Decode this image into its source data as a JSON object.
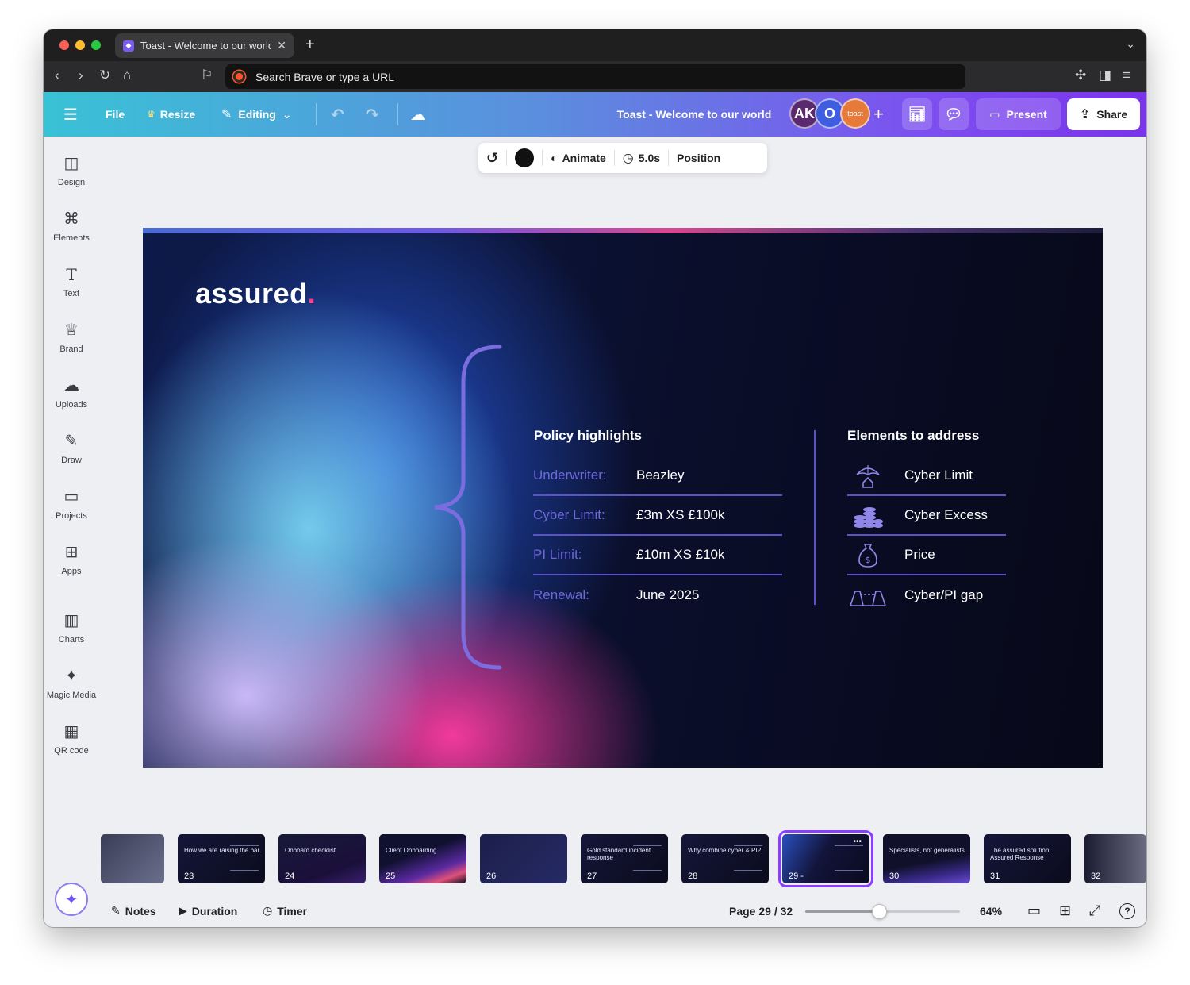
{
  "browser": {
    "tab_title": "Toast - Welcome to our world",
    "tab_close": "✕",
    "new_tab": "+",
    "url_placeholder": "Search Brave or type a URL"
  },
  "header": {
    "file_label": "File",
    "resize_label": "Resize",
    "editing_label": "Editing",
    "doc_title": "Toast - Welcome to our world",
    "avatars": [
      "AK",
      "O",
      "toast"
    ],
    "add_label": "+",
    "present_label": "Present",
    "share_label": "Share"
  },
  "sidebar": {
    "items": [
      {
        "label": "Design",
        "icon": "design-icon"
      },
      {
        "label": "Elements",
        "icon": "elements-icon"
      },
      {
        "label": "Text",
        "icon": "text-icon"
      },
      {
        "label": "Brand",
        "icon": "brand-icon"
      },
      {
        "label": "Uploads",
        "icon": "uploads-icon"
      },
      {
        "label": "Draw",
        "icon": "draw-icon"
      },
      {
        "label": "Projects",
        "icon": "projects-icon"
      },
      {
        "label": "Apps",
        "icon": "apps-icon"
      },
      {
        "label": "Charts",
        "icon": "charts-icon"
      },
      {
        "label": "Magic Media",
        "icon": "magic-media-icon"
      },
      {
        "label": "QR code",
        "icon": "qr-code-icon"
      }
    ]
  },
  "float_toolbar": {
    "color": "#111111",
    "animate_label": "Animate",
    "duration_label": "5.0s",
    "position_label": "Position"
  },
  "slide": {
    "logo": "assured",
    "logo_dot": ".",
    "policy_title": "Policy highlights",
    "policy_rows": [
      {
        "key": "Underwriter:",
        "value": "Beazley"
      },
      {
        "key": "Cyber Limit:",
        "value": "£3m XS £100k"
      },
      {
        "key": "PI Limit:",
        "value": "£10m XS £10k"
      },
      {
        "key": "Renewal:",
        "value": "June 2025"
      }
    ],
    "elements_title": "Elements to address",
    "elements_rows": [
      {
        "label": "Cyber Limit",
        "icon": "umbrella-house-icon"
      },
      {
        "label": "Cyber Excess",
        "icon": "coin-stacks-icon"
      },
      {
        "label": "Price",
        "icon": "money-bag-icon"
      },
      {
        "label": "Cyber/PI gap",
        "icon": "bridge-gap-icon"
      }
    ]
  },
  "filmstrip": {
    "thumbs": [
      {
        "num": "",
        "text": ""
      },
      {
        "num": "23",
        "text": "How we are raising the bar."
      },
      {
        "num": "24",
        "text": "Onboard checklist"
      },
      {
        "num": "25",
        "text": "Client Onboarding"
      },
      {
        "num": "26",
        "text": ""
      },
      {
        "num": "27",
        "text": "Gold standard incident response"
      },
      {
        "num": "28",
        "text": "Why combine cyber & PI?"
      },
      {
        "num": "29 -",
        "text": ""
      },
      {
        "num": "30",
        "text": "Specialists, not generalists."
      },
      {
        "num": "31",
        "text": "The assured solution: Assured Response"
      },
      {
        "num": "32",
        "text": ""
      }
    ],
    "active_index": 7,
    "more_label": "•••"
  },
  "bottombar": {
    "notes_label": "Notes",
    "duration_label": "Duration",
    "timer_label": "Timer",
    "page_label": "Page 29 / 32",
    "zoom_label": "64%",
    "zoom_fraction": 0.48
  }
}
